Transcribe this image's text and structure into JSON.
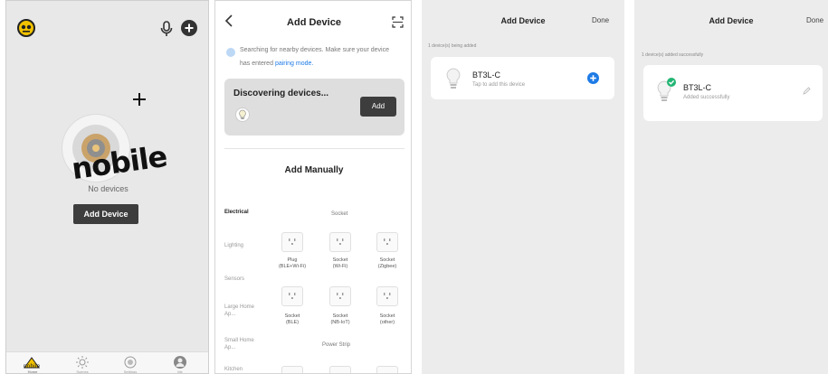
{
  "screen1": {
    "empty_text": "No devices",
    "add_device_button": "Add Device",
    "logo_text": "nobile",
    "nav": [
      {
        "label": "Home",
        "icon": "house-icon"
      },
      {
        "label": "Scenes",
        "icon": "sun-icon"
      },
      {
        "label": "Settings",
        "icon": "settings-icon"
      },
      {
        "label": "Me",
        "icon": "person-icon"
      }
    ]
  },
  "screen2": {
    "title": "Add Device",
    "searching_text": "Searching for nearby devices. Make sure your device",
    "searching_text2": "has entered",
    "pairing_mode_link": "pairing mode.",
    "discovering_title": "Discovering devices...",
    "add_button": "Add",
    "add_manually": "Add Manually",
    "categories": [
      "Electrical",
      "Lighting",
      "Sensors",
      "Large Home Ap...",
      "Small Home Ap...",
      "Kitchen"
    ],
    "group_header": "Socket",
    "devices_row1": [
      {
        "line1": "Plug",
        "line2": "(BLE+Wi-Fi)"
      },
      {
        "line1": "Socket",
        "line2": "(Wi-Fi)"
      },
      {
        "line1": "Socket",
        "line2": "(Zigbee)"
      }
    ],
    "devices_row2": [
      {
        "line1": "Socket",
        "line2": "(BLE)"
      },
      {
        "line1": "Socket",
        "line2": "(NB-IoT)"
      },
      {
        "line1": "Socket",
        "line2": "(other)"
      }
    ],
    "group_header2": "Power Strip"
  },
  "screen3": {
    "title": "Add Device",
    "done": "Done",
    "status": "1 device(s) being added",
    "device_name": "BT3L-C",
    "device_hint": "Tap to add this device"
  },
  "screen4": {
    "title": "Add Device",
    "done": "Done",
    "status": "1 device(s) added successfully",
    "device_name": "BT3L-C",
    "device_status": "Added successfully"
  },
  "colors": {
    "accent_blue": "#1e7be6",
    "success_green": "#22b573",
    "dark_button": "#3d3d3d"
  }
}
